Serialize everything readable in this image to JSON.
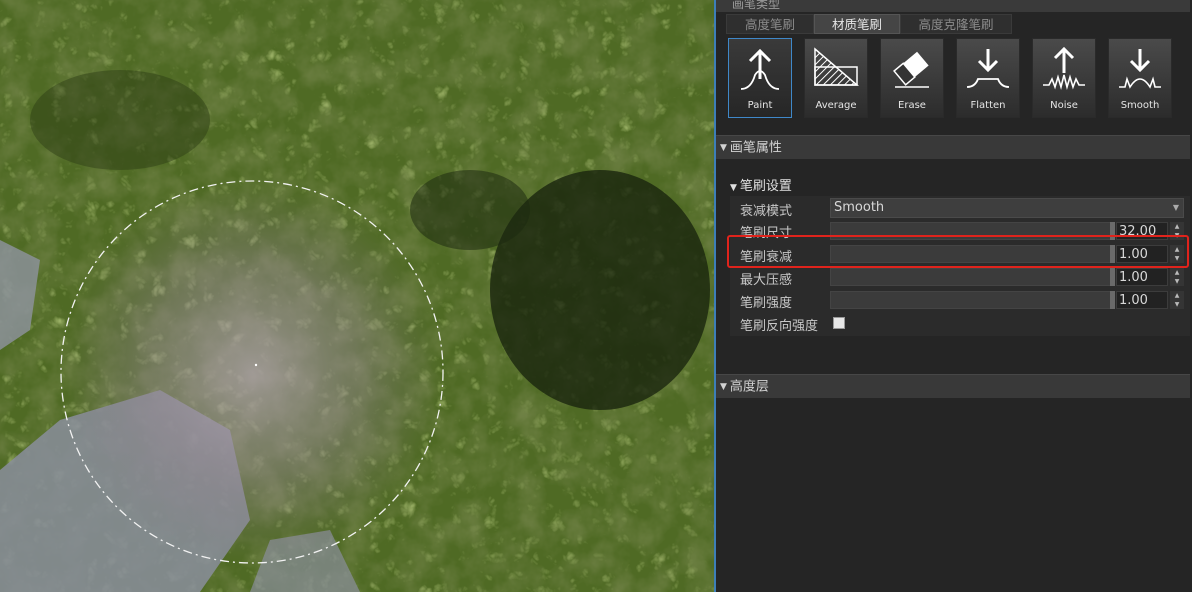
{
  "panel": {
    "brush_type_title": "画笔类型",
    "tabs": [
      {
        "label": "高度笔刷",
        "active": false
      },
      {
        "label": "材质笔刷",
        "active": true
      },
      {
        "label": "高度克隆笔刷",
        "active": false
      }
    ],
    "tools": [
      {
        "label": "Paint",
        "icon": "paint-icon",
        "active": true
      },
      {
        "label": "Average",
        "icon": "average-icon",
        "active": false
      },
      {
        "label": "Erase",
        "icon": "erase-icon",
        "active": false
      },
      {
        "label": "Flatten",
        "icon": "flatten-icon",
        "active": false
      },
      {
        "label": "Noise",
        "icon": "noise-icon",
        "active": false
      },
      {
        "label": "Smooth",
        "icon": "smooth-icon",
        "active": false
      }
    ],
    "brush_properties_title": "画笔属性",
    "brush_settings_title": "笔刷设置",
    "falloff_mode": {
      "label": "衰减模式",
      "value": "Smooth"
    },
    "brush_size": {
      "label": "笔刷尺寸",
      "value": "32.00"
    },
    "brush_falloff": {
      "label": "笔刷衰减",
      "value": "1.00"
    },
    "max_pressure": {
      "label": "最大压感",
      "value": "1.00"
    },
    "brush_strength": {
      "label": "笔刷强度",
      "value": "1.00"
    },
    "brush_invert_strength": {
      "label": "笔刷反向强度",
      "checked": false
    },
    "height_layer_title": "高度层"
  },
  "colors": {
    "accent": "#3f88c9",
    "highlight": "#e0231c"
  }
}
